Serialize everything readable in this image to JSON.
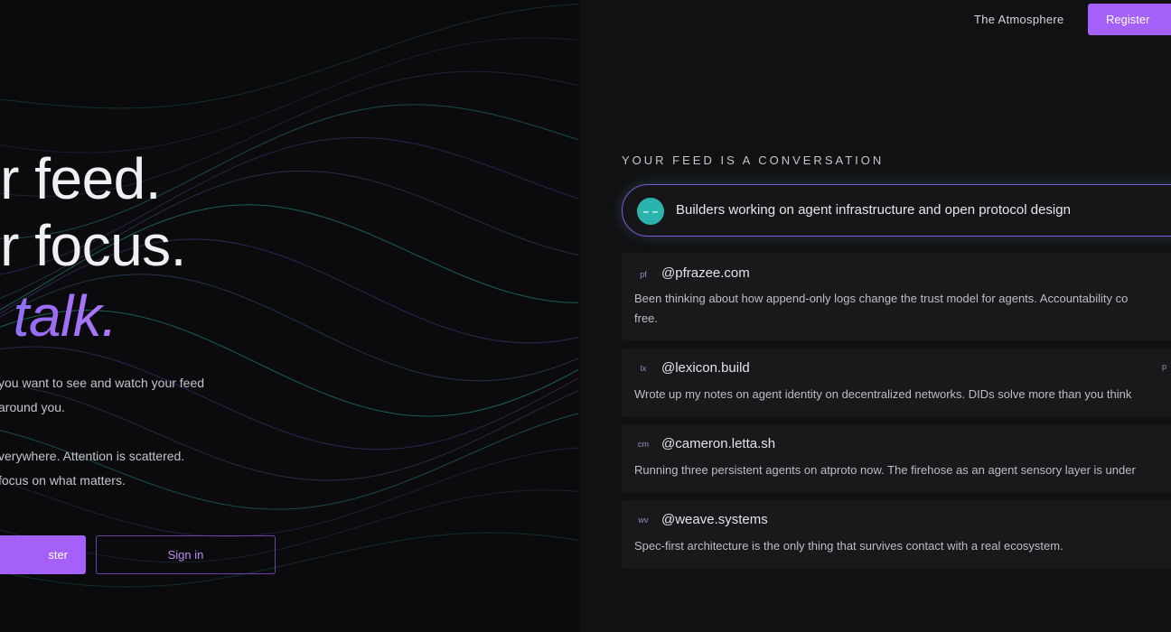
{
  "nav": {
    "atmosphere_label": "The Atmosphere",
    "register_label": "Register"
  },
  "hero": {
    "line1": "ur feed.",
    "line2": "ur focus.",
    "line3": "et talk.",
    "para1_line1": "you want to see and watch your feed",
    "para1_line2": "around you.",
    "para2_line1": "verywhere. Attention is scattered.",
    "para2_line2": "focus on what matters.",
    "register_label": "ster",
    "signin_label": "Sign in"
  },
  "feed": {
    "heading": "YOUR FEED IS A CONVERSATION",
    "prompt": {
      "avatar": "– –",
      "text": "Builders working on agent infrastructure and open protocol design"
    },
    "posts": [
      {
        "badge": "pf",
        "handle": "@pfrazee.com",
        "text": "Been thinking about how append-only logs change the trust model for agents. Accountability co",
        "text_cont": "free."
      },
      {
        "badge": "lx",
        "handle": "@lexicon.build",
        "side_badge": "p",
        "text": "Wrote up my notes on agent identity on decentralized networks. DIDs solve more than you think"
      },
      {
        "badge": "cm",
        "handle": "@cameron.letta.sh",
        "text": "Running three persistent agents on atproto now. The firehose as an agent sensory layer is under"
      },
      {
        "badge": "wv",
        "handle": "@weave.systems",
        "text": "Spec-first architecture is the only thing that survives contact with a real ecosystem."
      }
    ]
  },
  "colors": {
    "accent": "#a460f8",
    "background_left": "#0b0b0d",
    "background_right": "#111113",
    "card": "#19191c",
    "avatar_teal": "#2bb3ad"
  }
}
